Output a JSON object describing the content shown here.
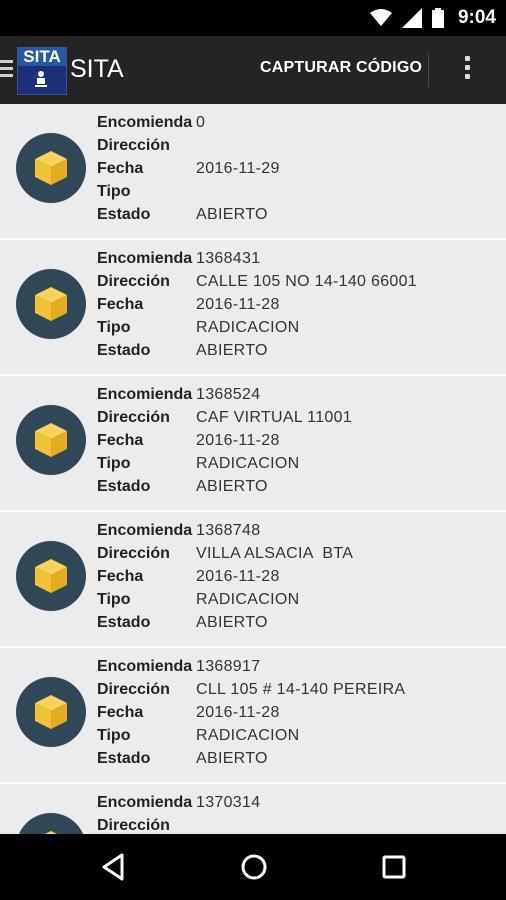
{
  "status_bar": {
    "time": "9:04"
  },
  "app_bar": {
    "logo_text": "SITA",
    "title": "SITA",
    "capture_label": "CAPTURAR CÓDIGO"
  },
  "labels": {
    "encomienda": "Encomienda",
    "direccion": "Dirección",
    "fecha": "Fecha",
    "tipo": "Tipo",
    "estado": "Estado"
  },
  "items": [
    {
      "encomienda": "0",
      "direccion": "",
      "fecha": "2016-11-29",
      "tipo": "",
      "estado": "ABIERTO"
    },
    {
      "encomienda": "1368431",
      "direccion": "CALLE 105 NO 14-140 66001",
      "fecha": "2016-11-28",
      "tipo": "RADICACION",
      "estado": "ABIERTO"
    },
    {
      "encomienda": "1368524",
      "direccion": "CAF VIRTUAL 11001",
      "fecha": "2016-11-28",
      "tipo": "RADICACION",
      "estado": "ABIERTO"
    },
    {
      "encomienda": "1368748",
      "direccion": "VILLA ALSACIA  BTA",
      "fecha": "2016-11-28",
      "tipo": "RADICACION",
      "estado": "ABIERTO"
    },
    {
      "encomienda": "1368917",
      "direccion": "CLL 105 # 14-140 PEREIRA",
      "fecha": "2016-11-28",
      "tipo": "RADICACION",
      "estado": "ABIERTO"
    },
    {
      "encomienda": "1370314",
      "direccion": "",
      "fecha": "",
      "tipo": "",
      "estado": ""
    }
  ],
  "icons": {
    "wifi": "wifi-icon",
    "signal": "signal-icon",
    "battery": "battery-icon",
    "menu": "hamburger-icon",
    "overflow": "more-vert-icon",
    "item": "package-box-icon",
    "back": "back-icon",
    "home": "home-icon",
    "recent": "recent-apps-icon"
  },
  "colors": {
    "box": "#f2c433",
    "circle": "#2f4756",
    "app_bar": "#242424"
  }
}
